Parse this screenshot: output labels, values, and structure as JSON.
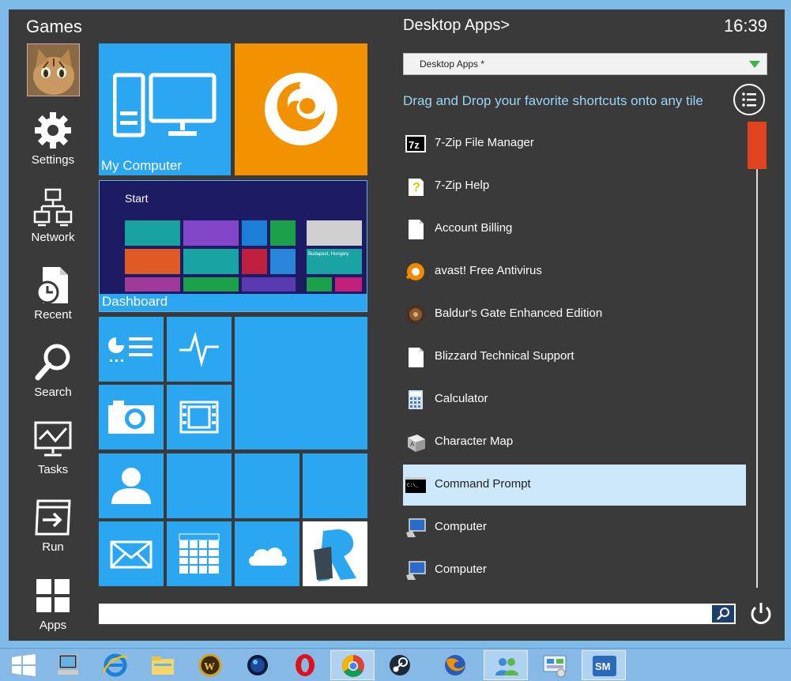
{
  "header": {
    "games_title": "Games",
    "apps_title": "Desktop Apps>",
    "clock": "16:39"
  },
  "sidebar": {
    "items": [
      {
        "label": "Settings",
        "icon": "gear-icon"
      },
      {
        "label": "Network",
        "icon": "network-icon"
      },
      {
        "label": "Recent",
        "icon": "recent-icon"
      },
      {
        "label": "Search",
        "icon": "search-icon"
      },
      {
        "label": "Tasks",
        "icon": "tasks-icon"
      },
      {
        "label": "Run",
        "icon": "run-icon"
      },
      {
        "label": "Apps",
        "icon": "apps-icon"
      }
    ]
  },
  "tiles": {
    "my_computer": "My Computer",
    "dashboard": "Dashboard",
    "dashboard_start": "Start",
    "dashboard_caption": "Budapest, Hungary"
  },
  "apps_dropdown": {
    "selected": "Desktop Apps *"
  },
  "hint": "Drag and Drop your favorite shortcuts onto any tile",
  "app_list": [
    {
      "name": "7-Zip File Manager",
      "icon": "7zip-icon"
    },
    {
      "name": "7-Zip Help",
      "icon": "help-file-icon"
    },
    {
      "name": "Account Billing",
      "icon": "document-icon"
    },
    {
      "name": "avast! Free Antivirus",
      "icon": "avast-icon"
    },
    {
      "name": "Baldur's Gate Enhanced Edition",
      "icon": "baldurs-gate-icon"
    },
    {
      "name": "Blizzard Technical Support",
      "icon": "document-icon"
    },
    {
      "name": "Calculator",
      "icon": "calculator-icon"
    },
    {
      "name": "Character Map",
      "icon": "character-map-icon"
    },
    {
      "name": "Command Prompt",
      "icon": "command-prompt-icon",
      "selected": true
    },
    {
      "name": "Computer",
      "icon": "computer-icon"
    },
    {
      "name": "Computer",
      "icon": "computer-icon"
    }
  ],
  "colors": {
    "tile_blue": "#2aa7f0",
    "firefox_orange": "#f39200",
    "menu_bg": "#3a3a3a",
    "scroll_thumb": "#e0441f",
    "hint_text": "#9ad7f0"
  },
  "taskbar": {
    "items": [
      "windows-start-icon",
      "computer-icon",
      "internet-explorer-icon",
      "file-explorer-icon",
      "wow-icon",
      "globe-icon",
      "opera-icon",
      "chrome-icon",
      "steam-icon",
      "firefox-icon",
      "people-icon",
      "control-panel-icon",
      "start-menu-icon"
    ]
  }
}
